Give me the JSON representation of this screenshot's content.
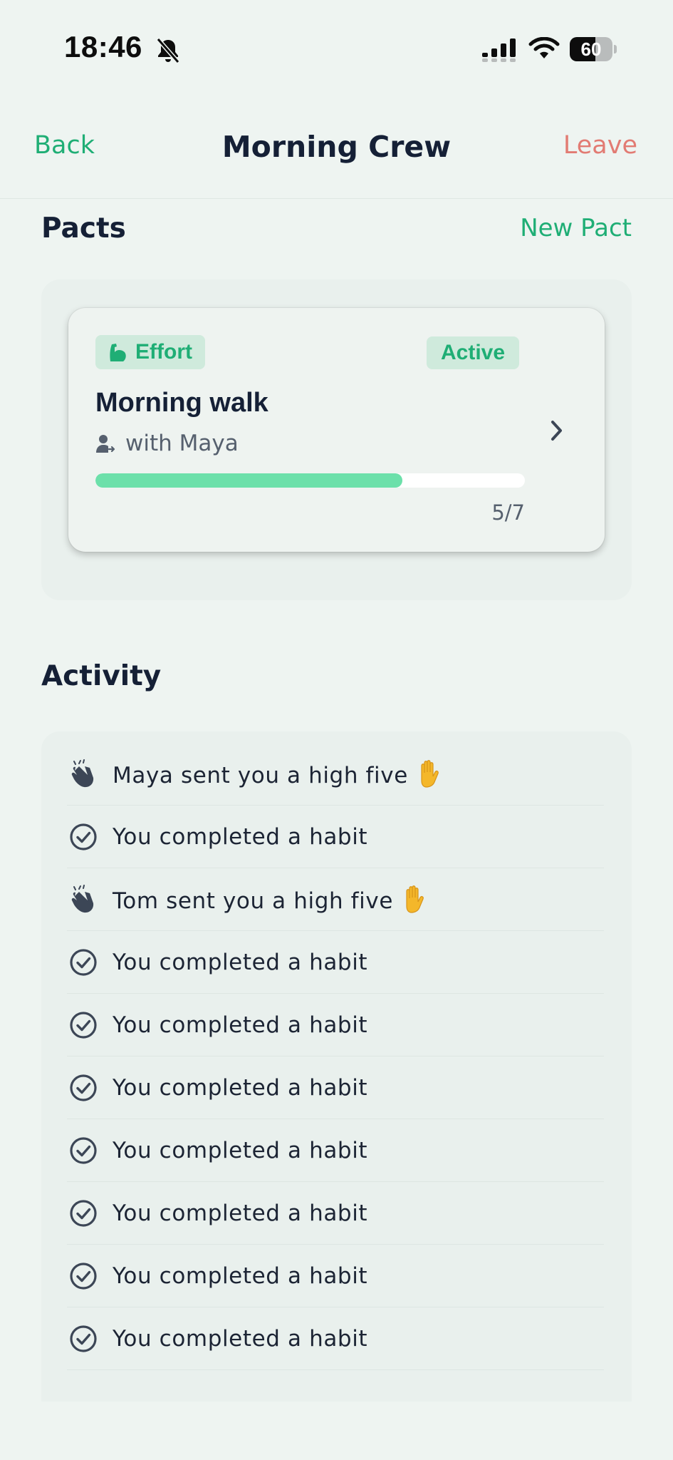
{
  "status_bar": {
    "time": "18:46",
    "battery_percent": "60",
    "battery_level": 0.6
  },
  "header": {
    "back_label": "Back",
    "title": "Morning Crew",
    "leave_label": "Leave"
  },
  "pacts": {
    "title": "Pacts",
    "new_pact_label": "New Pact",
    "cards": [
      {
        "type_label": "Effort",
        "status": "Active",
        "name": "Morning walk",
        "partner": "with Maya",
        "progress_text": "5/7",
        "progress_fraction": 0.714
      }
    ]
  },
  "activity": {
    "title": "Activity",
    "items": [
      {
        "icon": "clap-icon",
        "text": "Maya sent you a high five",
        "emoji": true
      },
      {
        "icon": "check-circle-icon",
        "text": "You completed a habit",
        "emoji": false
      },
      {
        "icon": "clap-icon",
        "text": "Tom sent you a high five",
        "emoji": true
      },
      {
        "icon": "check-circle-icon",
        "text": "You completed a habit",
        "emoji": false
      },
      {
        "icon": "check-circle-icon",
        "text": "You completed a habit",
        "emoji": false
      },
      {
        "icon": "check-circle-icon",
        "text": "You completed a habit",
        "emoji": false
      },
      {
        "icon": "check-circle-icon",
        "text": "You completed a habit",
        "emoji": false
      },
      {
        "icon": "check-circle-icon",
        "text": "You completed a habit",
        "emoji": false
      },
      {
        "icon": "check-circle-icon",
        "text": "You completed a habit",
        "emoji": false
      },
      {
        "icon": "check-circle-icon",
        "text": "You completed a habit",
        "emoji": false
      }
    ]
  },
  "colors": {
    "accent": "#1fae75",
    "danger": "#e27b73",
    "progress": "#6ce0aa",
    "background": "#eef4f1"
  }
}
